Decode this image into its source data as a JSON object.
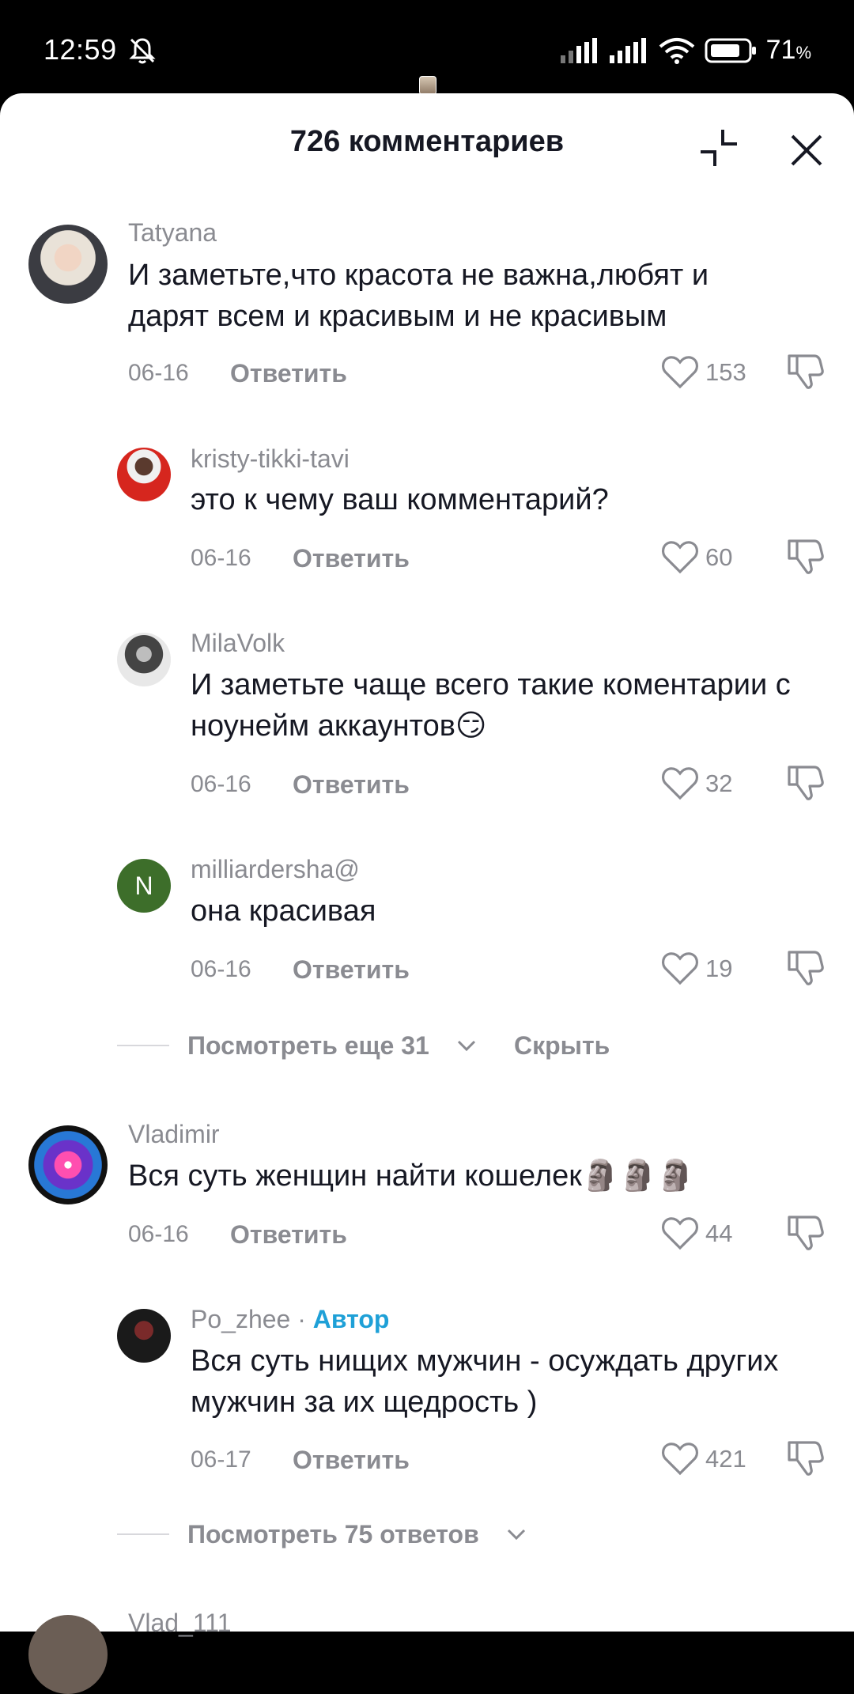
{
  "status_bar": {
    "time": "12:59",
    "battery_percent": "71",
    "battery_unit": "%",
    "icons": [
      "silent-mode-icon",
      "signal-icon",
      "signal-icon",
      "wifi-icon",
      "battery-icon"
    ]
  },
  "sheet": {
    "title": "726 комментариев"
  },
  "comments": [
    {
      "user": "Tatyana",
      "text": "И заметьте,что красота не важна,любят и дарят всем и красивым и не красивым",
      "date": "06-16",
      "reply": "Ответить",
      "likes": "153"
    },
    {
      "user": "kristy-tikki-tavi",
      "text": "это к чему ваш комментарий?",
      "date": "06-16",
      "reply": "Ответить",
      "likes": "60"
    },
    {
      "user": "MilaVolk",
      "text": "И заметьте чаще всего такие коментарии с ноунейм аккаунтов😏",
      "date": "06-16",
      "reply": "Ответить",
      "likes": "32"
    },
    {
      "user": "milliardersha@",
      "avatar_letter": "N",
      "text": "она красивая",
      "date": "06-16",
      "reply": "Ответить",
      "likes": "19"
    },
    {
      "user": "Vladimir",
      "text": "Вся суть женщин найти кошелек🗿🗿🗿",
      "date": "06-16",
      "reply": "Ответить",
      "likes": "44"
    },
    {
      "user": "Po_zhee",
      "sep": " · ",
      "badge": "Автор",
      "text": "Вся суть нищих мужчин - осуждать других мужчин за их щедрость )",
      "date": "06-17",
      "reply": "Ответить",
      "likes": "421"
    },
    {
      "user": "Vlad_111"
    }
  ],
  "more_replies_1": {
    "label": "Посмотреть еще 31",
    "hide": "Скрыть"
  },
  "more_replies_2": {
    "label": "Посмотреть 75 ответов"
  },
  "colors": {
    "accent_author": "#1ea0d7",
    "muted": "#8a8b91",
    "text": "#161823"
  }
}
